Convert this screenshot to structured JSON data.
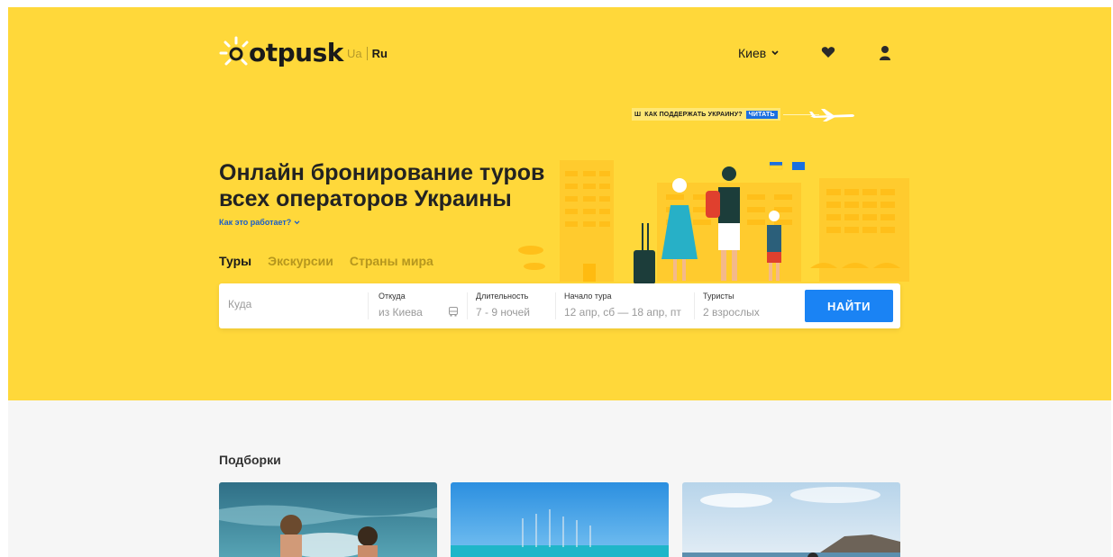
{
  "header": {
    "logo_text": "otpusk",
    "lang_ua": "Ua",
    "lang_ru": "Ru",
    "city": "Киев",
    "icons": [
      "heart-icon",
      "user-icon",
      "chevron-down-icon"
    ]
  },
  "banner": {
    "text": "КАК ПОДДЕРЖАТЬ УКРАИНУ?",
    "read": "ЧИТАТЬ",
    "icon": "trident-icon"
  },
  "hero": {
    "title_line1": "Онлайн бронирование туров",
    "title_line2": "всех операторов Украины",
    "how_link": "Как это работает?",
    "background": "#ffd83a"
  },
  "tabs": [
    {
      "label": "Туры",
      "active": true
    },
    {
      "label": "Экскурсии",
      "active": false
    },
    {
      "label": "Страны мира",
      "active": false
    }
  ],
  "search": {
    "where_placeholder": "Куда",
    "from_label": "Откуда",
    "from_value": "из Киева",
    "duration_label": "Длительность",
    "duration_value": "7 - 9 ночей",
    "start_label": "Начало тура",
    "start_value": "12 апр, сб — 18 апр, пт",
    "tourists_label": "Туристы",
    "tourists_value": "2 взрослых",
    "button": "НАЙТИ",
    "button_color": "#1a83f4"
  },
  "selections": {
    "title": "Подборки"
  }
}
